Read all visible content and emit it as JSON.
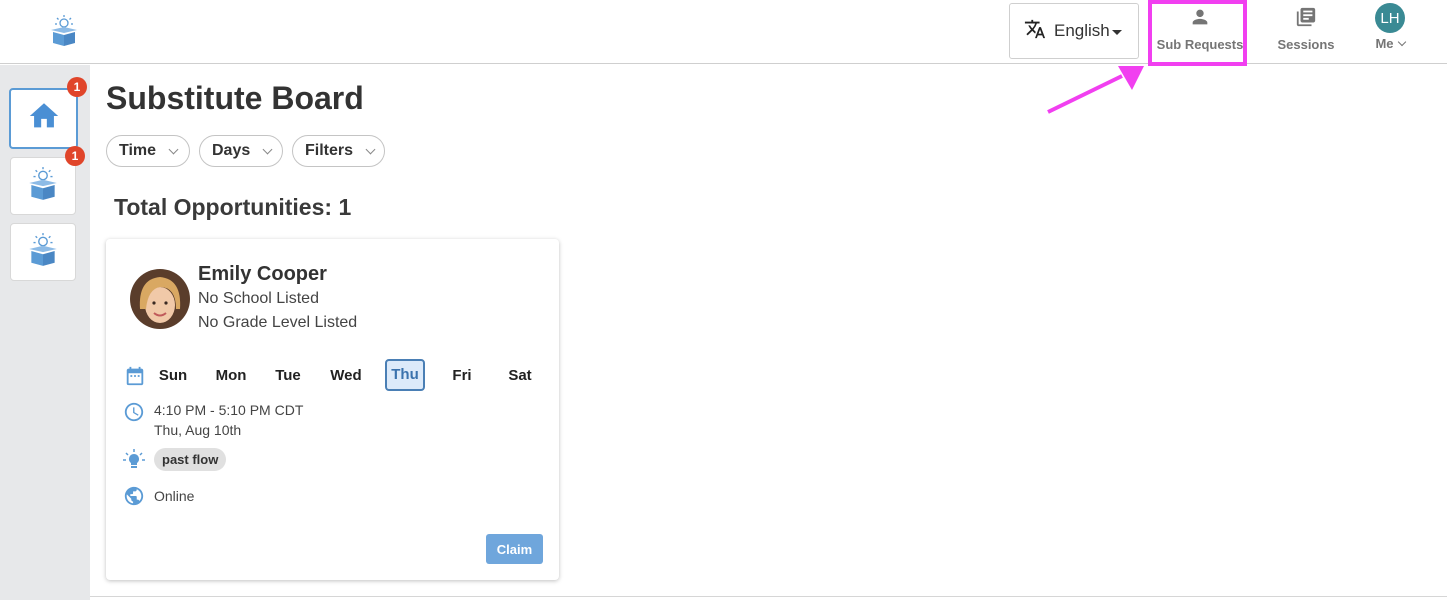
{
  "header": {
    "language": {
      "label": "English"
    },
    "nav": {
      "sub_requests": "Sub Requests",
      "sessions": "Sessions",
      "me": "Me",
      "avatar_initials": "LH"
    }
  },
  "sidebar": {
    "items": [
      {
        "icon": "home-icon",
        "badge": "1",
        "active": true
      },
      {
        "icon": "lightbulb-box-icon",
        "badge": "1",
        "active": false
      },
      {
        "icon": "lightbulb-box-icon",
        "badge": null,
        "active": false
      }
    ]
  },
  "main": {
    "title": "Substitute Board",
    "filters": [
      "Time",
      "Days",
      "Filters"
    ],
    "total_label": "Total Opportunities: 1"
  },
  "card": {
    "name": "Emily Cooper",
    "school": "No School Listed",
    "grade": "No Grade Level Listed",
    "days": [
      "Sun",
      "Mon",
      "Tue",
      "Wed",
      "Thu",
      "Fri",
      "Sat"
    ],
    "selected_day": "Thu",
    "time": "4:10 PM - 5:10 PM CDT",
    "date": "Thu, Aug 10th",
    "tag": "past flow",
    "location": "Online",
    "claim_label": "Claim"
  },
  "colors": {
    "accent": "#5b9bd5",
    "badge": "#e0452a",
    "highlight": "#f13ff0",
    "avatar": "#3a8a94"
  }
}
